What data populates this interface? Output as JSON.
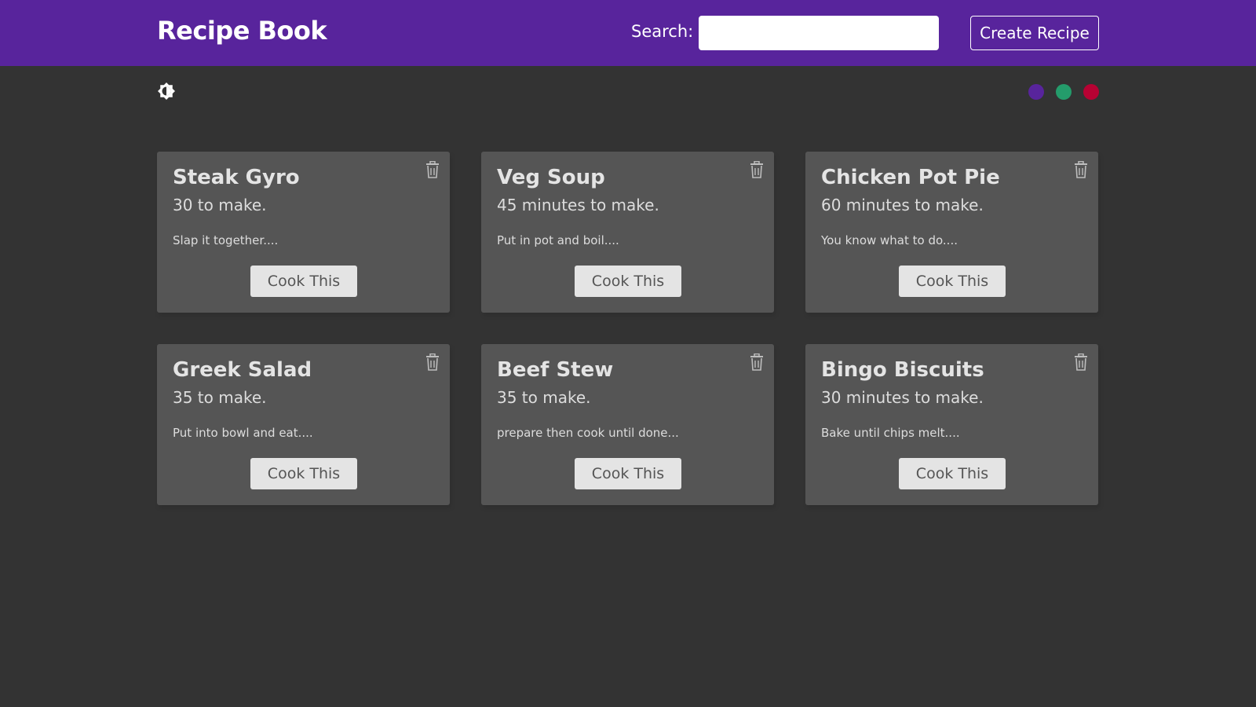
{
  "app": {
    "title": "Recipe Book"
  },
  "header": {
    "search_label": "Search:",
    "search_value": "",
    "create_label": "Create Recipe"
  },
  "theme": {
    "toggle_icon": "brightness-contrast-icon",
    "colors": [
      {
        "name": "purple",
        "hex": "#58249c"
      },
      {
        "name": "green",
        "hex": "#249c6b"
      },
      {
        "name": "red",
        "hex": "#b70233"
      }
    ]
  },
  "colors": {
    "navbar": "#58249c",
    "background": "#333333",
    "card": "#555555",
    "button": "#e4e4e4"
  },
  "recipes": [
    {
      "title": "Steak Gyro",
      "time": "30 to make.",
      "method": "Slap it together....",
      "button": "Cook This",
      "icon": "trash-icon"
    },
    {
      "title": "Veg Soup",
      "time": "45 minutes to make.",
      "method": "Put in pot and boil....",
      "button": "Cook This",
      "icon": "trash-icon"
    },
    {
      "title": "Chicken Pot Pie",
      "time": "60 minutes to make.",
      "method": "You know what to do....",
      "button": "Cook This",
      "icon": "trash-icon"
    },
    {
      "title": "Greek Salad",
      "time": "35 to make.",
      "method": "Put into bowl and eat....",
      "button": "Cook This",
      "icon": "trash-icon"
    },
    {
      "title": "Beef Stew",
      "time": "35 to make.",
      "method": "prepare then cook until done...",
      "button": "Cook This",
      "icon": "trash-icon"
    },
    {
      "title": "Bingo Biscuits",
      "time": "30 minutes to make.",
      "method": "Bake until chips melt....",
      "button": "Cook This",
      "icon": "trash-icon"
    }
  ]
}
